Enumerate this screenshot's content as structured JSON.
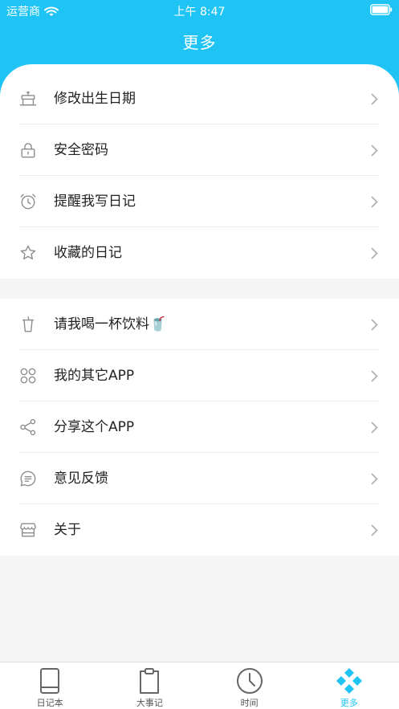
{
  "status_bar": {
    "carrier": "运营商",
    "time": "上午 8:47"
  },
  "header": {
    "title": "更多"
  },
  "theme": {
    "accent": "#1fc4f4",
    "background": "#f5f5f5",
    "text": "#222222",
    "icon": "#8c8c8c"
  },
  "groups": [
    {
      "items": [
        {
          "label": "修改出生日期",
          "icon": "cake-icon"
        },
        {
          "label": "安全密码",
          "icon": "lock-icon"
        },
        {
          "label": "提醒我写日记",
          "icon": "alarm-clock-icon"
        },
        {
          "label": "收藏的日记",
          "icon": "star-icon"
        }
      ]
    },
    {
      "items": [
        {
          "label": "请我喝一杯饮料🥤",
          "icon": "cup-icon"
        },
        {
          "label": "我的其它APP",
          "icon": "apps-grid-icon"
        },
        {
          "label": "分享这个APP",
          "icon": "share-icon"
        },
        {
          "label": "意见反馈",
          "icon": "feedback-icon"
        },
        {
          "label": "关于",
          "icon": "store-icon"
        }
      ]
    }
  ],
  "tab_bar": {
    "tabs": [
      {
        "label": "日记本",
        "icon": "notebook-icon",
        "active": false
      },
      {
        "label": "大事记",
        "icon": "clipboard-icon",
        "active": false
      },
      {
        "label": "时间",
        "icon": "clock-icon",
        "active": false
      },
      {
        "label": "更多",
        "icon": "diamonds-icon",
        "active": true
      }
    ]
  }
}
